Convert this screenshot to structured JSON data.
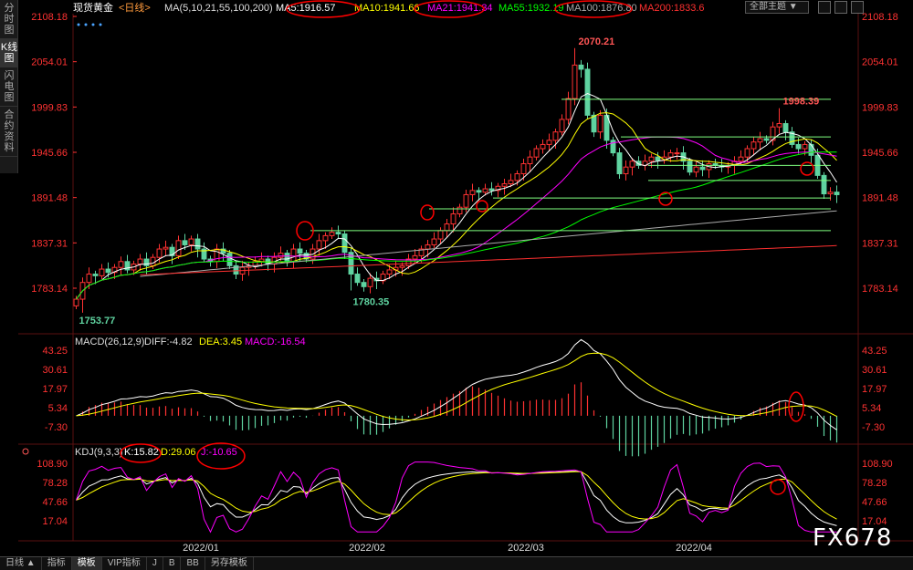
{
  "side_tabs": [
    "分时图",
    "K线图",
    "闪电图",
    "合约资料"
  ],
  "active_side_tab": 1,
  "bottom_tabs": [
    "日线 ▲",
    "指标",
    "模板",
    "VIP指标",
    "J",
    "B",
    "BB",
    "另存模板"
  ],
  "theme_button": "全部主题",
  "watermark": "FX678",
  "colors": {
    "up": "#ff3232",
    "down": "#5fd3a0",
    "ma5": "#ffffff",
    "ma10": "#ffff00",
    "ma21": "#ff00ff",
    "ma55": "#00ff00",
    "ma100": "#aaaaaa",
    "ma200": "#ff3030",
    "axis": "#ff3232",
    "annot": "#ff0000",
    "hline": "#7fff7f"
  },
  "price_panel": {
    "symbol": "现货黄金",
    "period": "<日线>",
    "ma_params": "MA(5,10,21,55,100,200)",
    "ma_labels": [
      "MA5:1916.57",
      "MA10:1941.66",
      "MA21:1941.34",
      "MA55:1932.19",
      "MA100:1876.80",
      "MA200:1833.6"
    ],
    "ticks": [
      "2108.18",
      "2054.01",
      "1999.83",
      "1945.66",
      "1891.48",
      "1837.31",
      "1783.14"
    ],
    "high_label": "2070.21",
    "low_label": "1780.35",
    "start_low_label": "1753.77",
    "high2_label": "1998.39"
  },
  "macd_panel": {
    "title": "MACD(26,12,9)",
    "labels": [
      "DIFF:-4.82",
      "DEA:3.45",
      "MACD:-16.54"
    ],
    "ticks": [
      "43.25",
      "30.61",
      "17.97",
      "5.34",
      "-7.30"
    ]
  },
  "kdj_panel": {
    "title": "KDJ(9,3,3)",
    "labels": [
      "K:15.82",
      "D:29.06",
      "J:-10.65"
    ],
    "ticks": [
      "108.90",
      "78.28",
      "47.66",
      "17.04"
    ]
  },
  "date_labels": [
    "2022/01",
    "2022/02",
    "2022/03",
    "2022/04"
  ],
  "chart_data": {
    "type": "candlestick",
    "symbol": "现货黄金",
    "period": "日线",
    "price_ticks": [
      2108.18,
      2054.01,
      1999.83,
      1945.66,
      1891.48,
      1837.31,
      1783.14
    ],
    "price_annotations": [
      {
        "label": "2070.21",
        "value": 2070.21
      },
      {
        "label": "1780.35",
        "value": 1780.35
      },
      {
        "label": "1753.77",
        "value": 1753.77
      },
      {
        "label": "1998.39",
        "value": 1998.39
      }
    ],
    "close": [
      1770,
      1790,
      1800,
      1798,
      1806,
      1802,
      1808,
      1815,
      1805,
      1812,
      1818,
      1810,
      1820,
      1830,
      1832,
      1822,
      1840,
      1835,
      1842,
      1830,
      1818,
      1815,
      1830,
      1825,
      1810,
      1800,
      1808,
      1810,
      1815,
      1818,
      1812,
      1820,
      1825,
      1815,
      1830,
      1825,
      1818,
      1830,
      1840,
      1846,
      1850,
      1848,
      1826,
      1800,
      1790,
      1785,
      1795,
      1792,
      1800,
      1805,
      1808,
      1810,
      1818,
      1822,
      1830,
      1835,
      1842,
      1852,
      1860,
      1872,
      1880,
      1895,
      1900,
      1898,
      1902,
      1900,
      1905,
      1908,
      1912,
      1920,
      1932,
      1940,
      1950,
      1955,
      1960,
      1970,
      1985,
      2010,
      2050,
      2045,
      1990,
      1970,
      1990,
      1960,
      1945,
      1920,
      1928,
      1935,
      1930,
      1935,
      1940,
      1936,
      1940,
      1945,
      1945,
      1935,
      1922,
      1928,
      1925,
      1932,
      1930,
      1928,
      1930,
      1935,
      1940,
      1950,
      1958,
      1962,
      1960,
      1976,
      1980,
      1970,
      1955,
      1950,
      1955,
      1942,
      1918,
      1896,
      1898,
      1895
    ]
  },
  "macd_data": {
    "ticks": [
      43.25,
      30.61,
      17.97,
      5.34,
      -7.3
    ],
    "diff_last": -4.82,
    "dea_last": 3.45,
    "macd_last": -16.54
  },
  "kdj_data": {
    "ticks": [
      108.9,
      78.28,
      47.66,
      17.04
    ],
    "k_last": 15.82,
    "d_last": 29.06,
    "j_last": -10.65
  }
}
